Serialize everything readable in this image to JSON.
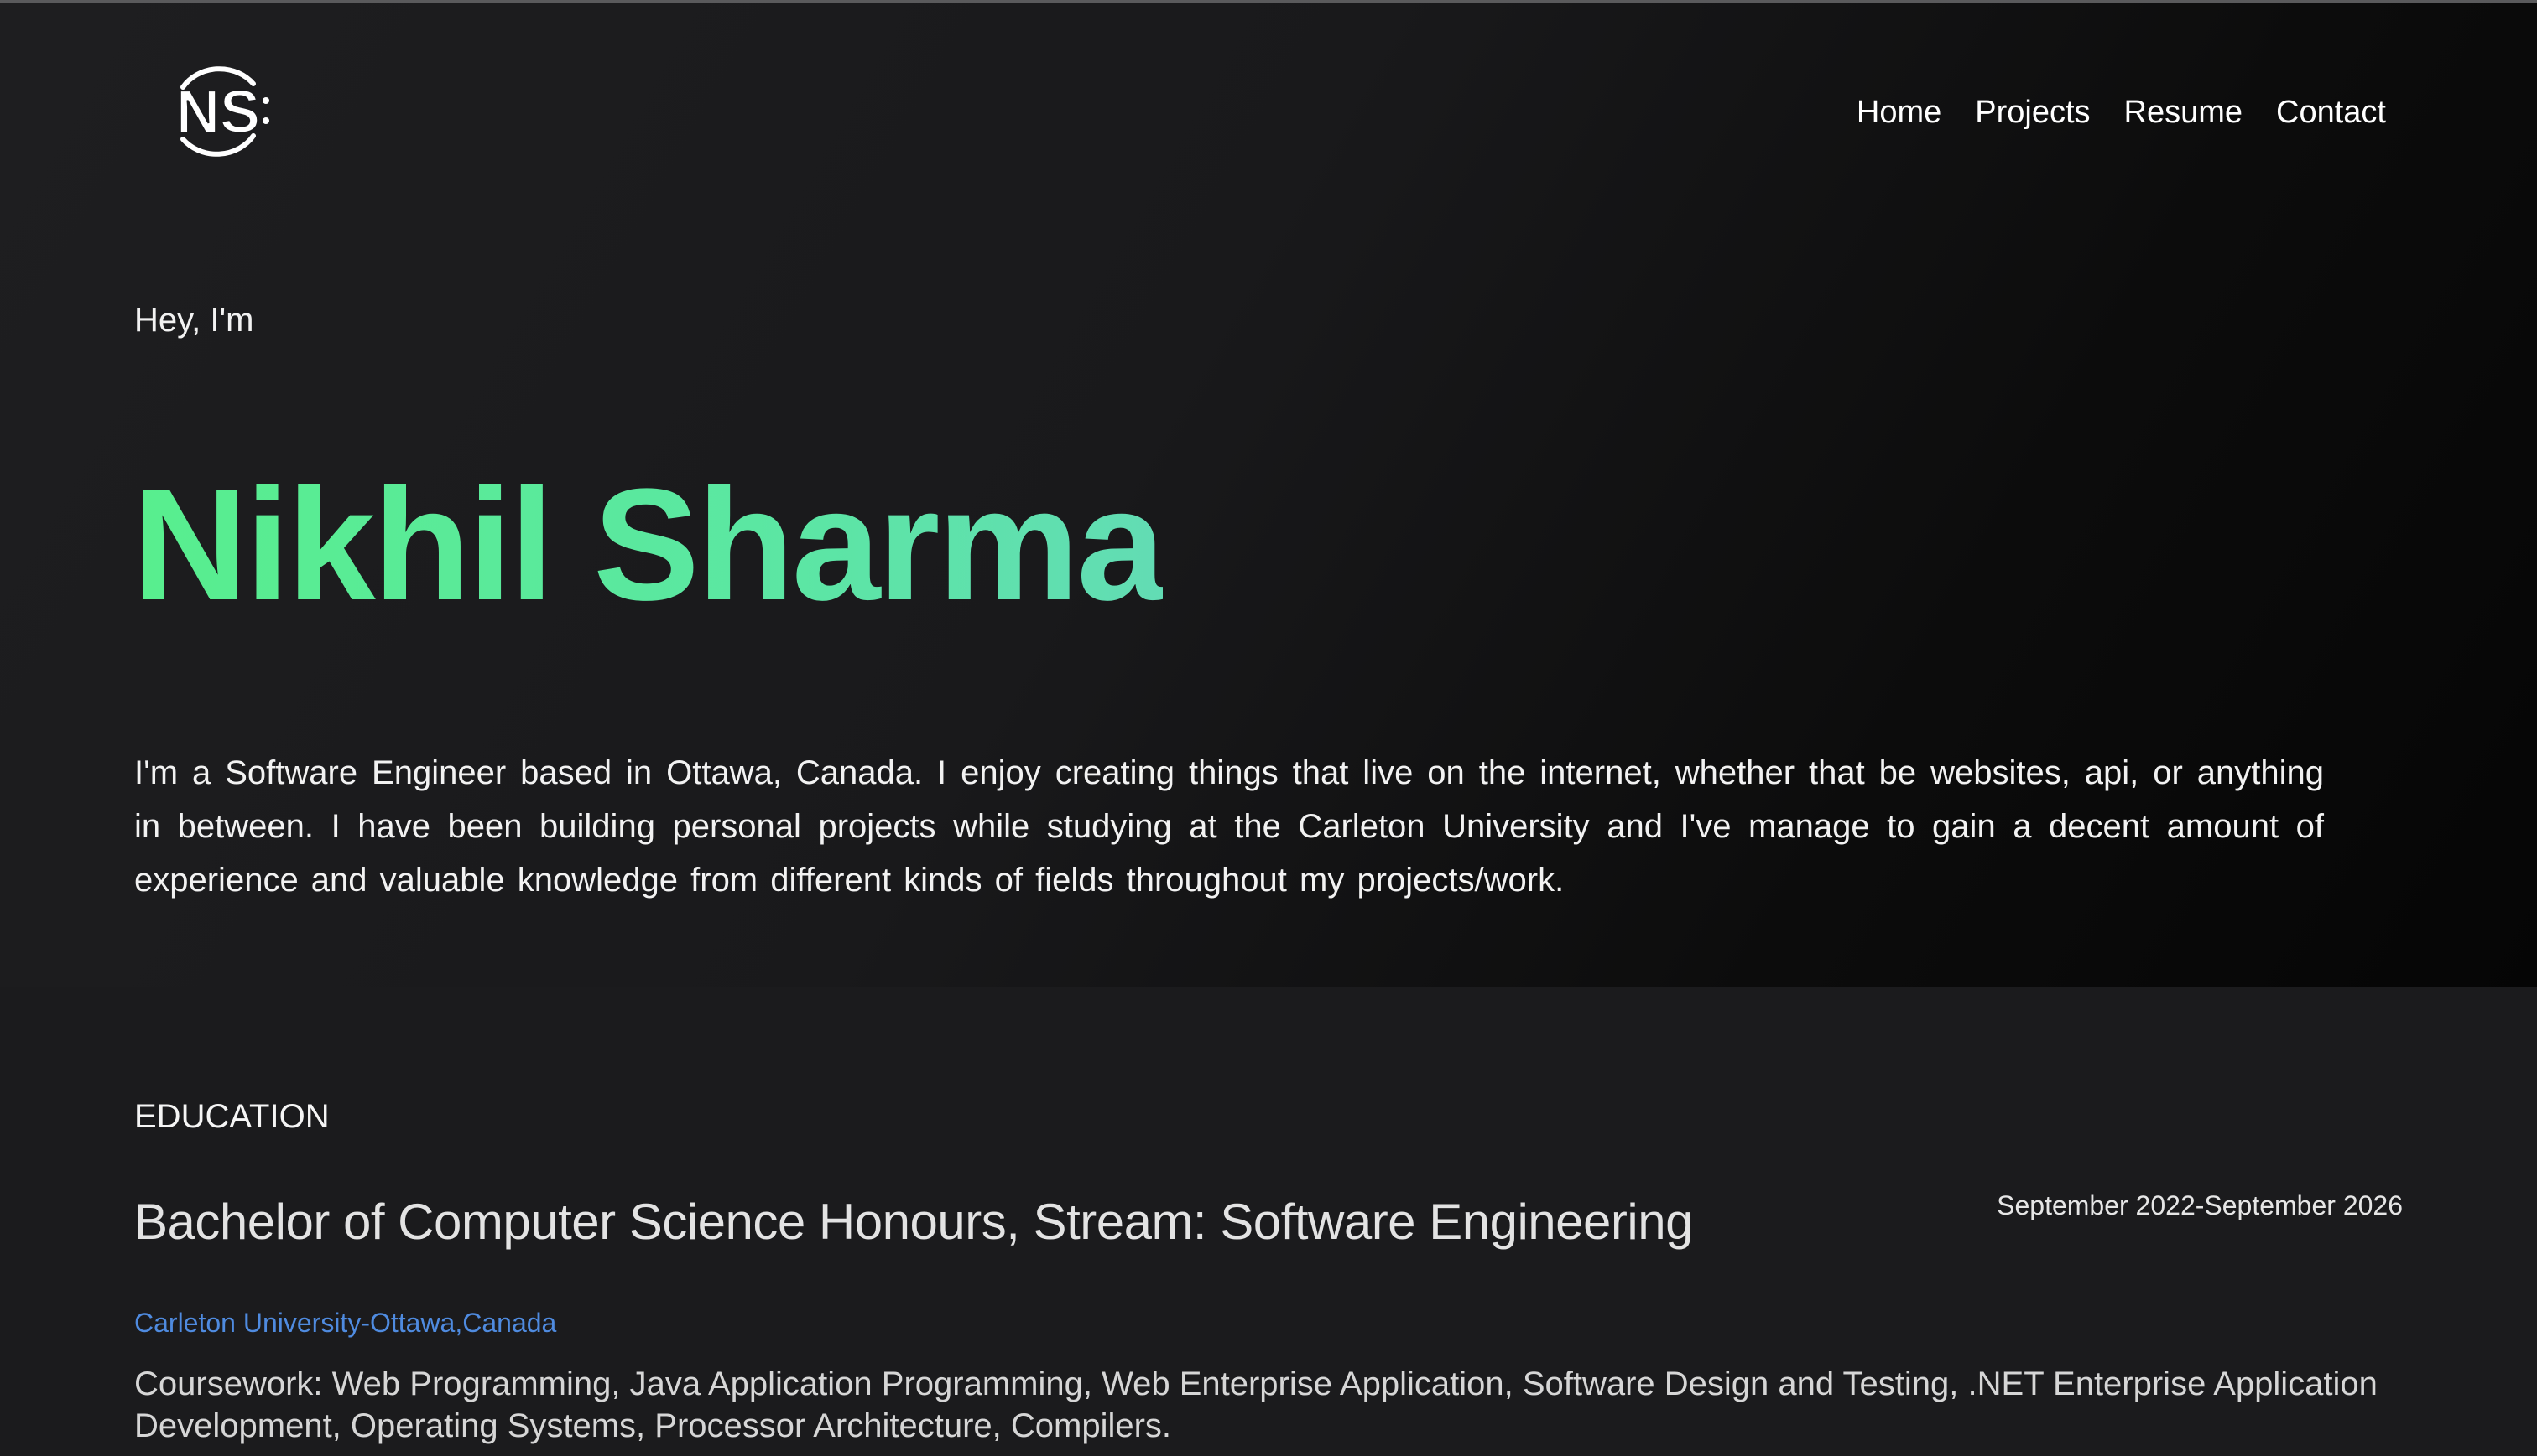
{
  "header": {
    "logo_text": "NS",
    "nav": {
      "home": "Home",
      "projects": "Projects",
      "resume": "Resume",
      "contact": "Contact"
    }
  },
  "hero": {
    "greeting": "Hey, I'm",
    "name": "Nikhil Sharma",
    "bio": "I'm a Software Engineer based in Ottawa, Canada. I enjoy creating things that live on the internet, whether that be websites, api, or anything in between. I have been building personal projects while studying at the Carleton University and I've manage to gain a decent amount of experience and valuable knowledge from different kinds of fields throughout my projects/work."
  },
  "education": {
    "heading": "EDUCATION",
    "degree": "Bachelor of Computer Science Honours, Stream: Software Engineering",
    "dates": "September 2022-September 2026",
    "institution": "Carleton University-Ottawa,Canada",
    "coursework": "Coursework: Web Programming, Java Application Programming, Web Enterprise Application, Software Design and Testing, .NET Enterprise Application Development, Operating Systems, Processor Architecture, Compilers."
  },
  "colors": {
    "name_gradient_start": "#58ee8e",
    "name_gradient_end": "#62dcb4",
    "link_blue": "#4f8be0",
    "background": "#1b1b1d"
  }
}
